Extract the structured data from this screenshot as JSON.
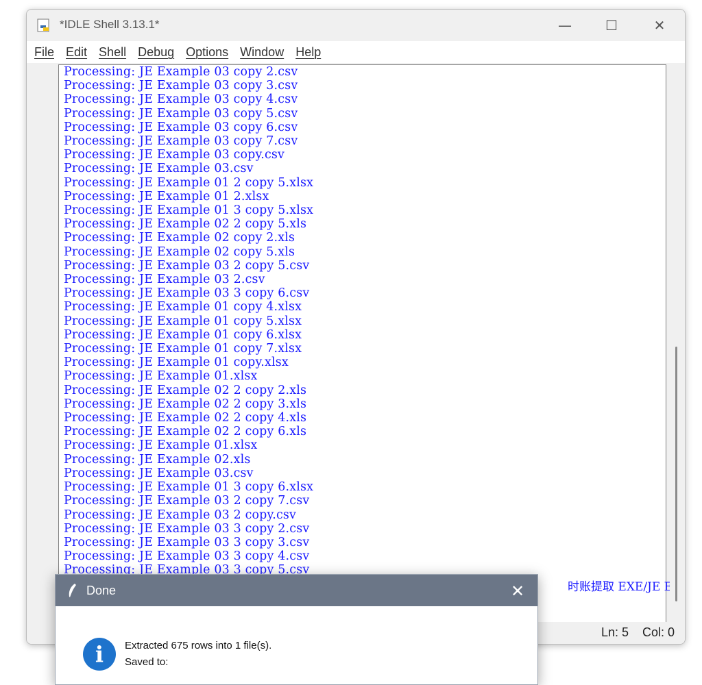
{
  "window": {
    "title": "*IDLE Shell 3.13.1*",
    "minimize_label": "—",
    "maximize_label": "☐",
    "close_label": "✕"
  },
  "menu": [
    "File",
    "Edit",
    "Shell",
    "Debug",
    "Options",
    "Window",
    "Help"
  ],
  "output_lines": [
    "Processing: JE Example 03 copy 2.csv",
    "Processing: JE Example 03 copy 3.csv",
    "Processing: JE Example 03 copy 4.csv",
    "Processing: JE Example 03 copy 5.csv",
    "Processing: JE Example 03 copy 6.csv",
    "Processing: JE Example 03 copy 7.csv",
    "Processing: JE Example 03 copy.csv",
    "Processing: JE Example 03.csv",
    "Processing: JE Example 01 2 copy 5.xlsx",
    "Processing: JE Example 01 2.xlsx",
    "Processing: JE Example 01 3 copy 5.xlsx",
    "Processing: JE Example 02 2 copy 5.xls",
    "Processing: JE Example 02 copy 2.xls",
    "Processing: JE Example 02 copy 5.xls",
    "Processing: JE Example 03 2 copy 5.csv",
    "Processing: JE Example 03 2.csv",
    "Processing: JE Example 03 3 copy 6.csv",
    "Processing: JE Example 01 copy 4.xlsx",
    "Processing: JE Example 01 copy 5.xlsx",
    "Processing: JE Example 01 copy 6.xlsx",
    "Processing: JE Example 01 copy 7.xlsx",
    "Processing: JE Example 01 copy.xlsx",
    "Processing: JE Example 01.xlsx",
    "Processing: JE Example 02 2 copy 2.xls",
    "Processing: JE Example 02 2 copy 3.xls",
    "Processing: JE Example 02 2 copy 4.xls",
    "Processing: JE Example 02 2 copy 6.xls",
    "Processing: JE Example 01.xlsx",
    "Processing: JE Example 02.xls",
    "Processing: JE Example 03.csv",
    "Processing: JE Example 01 3 copy 6.xlsx",
    "Processing: JE Example 03 2 copy 7.csv",
    "Processing: JE Example 03 2 copy.csv",
    "Processing: JE Example 03 3 copy 2.csv",
    "Processing: JE Example 03 3 copy 3.csv",
    "Processing: JE Example 03 3 copy 4.csv",
    "Processing: JE Example 03 3 copy 5.csv"
  ],
  "tail_text": "时账提取 EXE/JE E",
  "status": {
    "ln": "Ln: 5",
    "col": "Col: 0"
  },
  "dialog": {
    "title": "Done",
    "close_label": "✕",
    "info_label": "i",
    "message_line1": "Extracted 675 rows into 1 file(s).",
    "message_line2": "Saved to:"
  },
  "colors": {
    "output_text": "#1a1aff",
    "dialog_titlebar": "#6b7687",
    "info_icon": "#1e73cc"
  }
}
